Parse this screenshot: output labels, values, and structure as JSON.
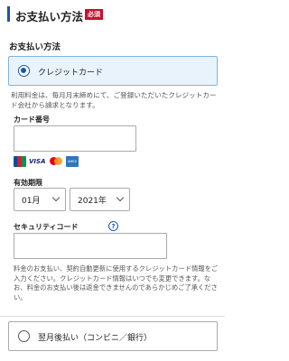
{
  "header": {
    "title": "お支払い方法",
    "required_badge": "必須",
    "accent_color": "#1a56a8",
    "badge_color": "#c8102e"
  },
  "payment": {
    "section_label": "お支払い方法",
    "selected_option": {
      "label": "クレジットカード",
      "selected": true
    },
    "notice": "利用料金は、毎月月末締めにて、ご登録いただいたクレジットカード会社から請求となります。",
    "card_number": {
      "label": "カード番号",
      "value": "",
      "placeholder": ""
    },
    "card_brands": [
      "JCB",
      "VISA",
      "Mastercard",
      "AMEX"
    ],
    "expiry": {
      "label": "有効期限",
      "month": "01月",
      "year": "2021年"
    },
    "security_code": {
      "label": "セキュリティコード",
      "help_icon": "?",
      "value": ""
    },
    "notes": "料金のお支払い、契約自動更新に使用するクレジットカード情報をご入力ください。クレジットカード情報はいつでも変更できます。なお、料金のお支払い後は返金できませんのであらかじめご了承ください。",
    "other_option": {
      "label": "翌月後払い（コンビニ／銀行）",
      "selected": false
    }
  }
}
